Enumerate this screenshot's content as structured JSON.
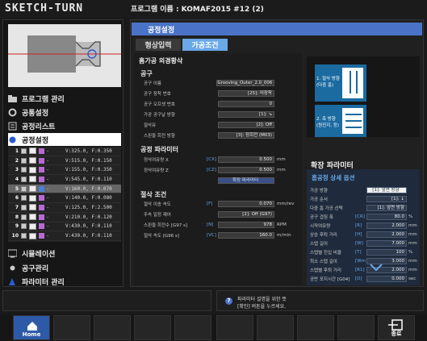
{
  "header": {
    "logo": "SKETCH-TURN",
    "program_title": "프로그램 이름 : KOMAF2015 #12 (2)"
  },
  "nav": [
    {
      "label": "프로그램 관리",
      "icon": "folder-icon"
    },
    {
      "label": "공통설정",
      "icon": "gear-icon"
    },
    {
      "label": "공정리스트",
      "icon": "list-icon"
    },
    {
      "label": "공정설정",
      "icon": "settings-icon"
    },
    {
      "label": "시뮬레이션",
      "icon": "simulation-icon"
    },
    {
      "label": "공구관리",
      "icon": "tool-icon"
    },
    {
      "label": "파라미터 관리",
      "icon": "parameter-icon"
    }
  ],
  "steps": [
    {
      "num": "1",
      "val": "V:325.0, F:0.350"
    },
    {
      "num": "2",
      "val": "V:515.0, F:0.150"
    },
    {
      "num": "3",
      "val": "V:155.0, F:0.350"
    },
    {
      "num": "4",
      "val": "V:545.0, F:0.110"
    },
    {
      "num": "5",
      "val": "V:160.0, F:0.070"
    },
    {
      "num": "6",
      "val": "V:140.0, F:0.080"
    },
    {
      "num": "7",
      "val": "V:125.0, F:2.500"
    },
    {
      "num": "8",
      "val": "V:210.0, F:0.120"
    },
    {
      "num": "9",
      "val": "V:430.0, F:0.110"
    },
    {
      "num": "10",
      "val": "V:430.0, F:0.110"
    }
  ],
  "main": {
    "section_title": "공정설정",
    "tabs": [
      "형상입력",
      "가공조건"
    ],
    "process_name": "홈가공 외경황삭",
    "tool_group": "공구",
    "tool_rows": [
      {
        "label": "공구 이름",
        "key": "",
        "value": "Grooving_Outer_2.0_006",
        "unit": ""
      },
      {
        "label": "공구 장착 번호",
        "key": "",
        "value": "[25]: 미장착",
        "unit": ""
      },
      {
        "label": "공구 오프셋 번호",
        "key": "",
        "value": "0",
        "unit": ""
      },
      {
        "label": "가공 공구날 방향",
        "key": "",
        "value": "[1]: ↘",
        "unit": ""
      },
      {
        "label": "절삭유",
        "key": "",
        "value": "[2]: Off",
        "unit": ""
      },
      {
        "label": "스핀들 회전 방향",
        "key": "",
        "value": "[3]: 정회전 (M03)",
        "unit": ""
      }
    ],
    "tool_param_group": "공정 파라미터",
    "param_rows": [
      {
        "label": "정삭여유량 X",
        "key": "[CX]",
        "value": "0.500",
        "unit": "mm"
      },
      {
        "label": "정삭여유량 Z",
        "key": "[CZ]",
        "value": "0.500",
        "unit": "mm"
      }
    ],
    "advanced_button": "확장 파라미터",
    "cut_group": "절삭 조건",
    "cut_rows": [
      {
        "label": "절삭 이송 속도",
        "key": "[F]",
        "value": "0.070",
        "unit": "mm/rev"
      },
      {
        "label": "주속 일정 제어",
        "key": "",
        "value": "[2]: Off (G97)",
        "unit": ""
      },
      {
        "label": "스핀들 회전수 [G97 s]",
        "key": "[N]",
        "value": "978",
        "unit": "RPM"
      },
      {
        "label": "절삭 속도 [G96 s]",
        "key": "[VC]",
        "value": "160.0",
        "unit": "m/min"
      }
    ]
  },
  "diagram": {
    "label1": "1. 절삭 방향\n(다중 홈)",
    "label2": "2. 축 방향\n(원진지, 등)"
  },
  "ext": {
    "title": "확장 파라미터",
    "subtitle": "홈공정 상세 옵션",
    "rows": [
      {
        "label": "가공 방향",
        "key": "",
        "value": "[1]: 앞면 방향",
        "unit": ""
      },
      {
        "label": "가공 순서",
        "key": "",
        "value": "[1]: ↓",
        "unit": ""
      },
      {
        "label": "다중 홈 가공 선택",
        "key": "",
        "value": "[1]: 앞면 방향",
        "unit": ""
      },
      {
        "label": "공구 겹침 폭",
        "key": "[CR]",
        "value": "80.0",
        "unit": "%"
      },
      {
        "label": "시작여유량",
        "key": "[R]",
        "value": "2.000",
        "unit": "mm"
      },
      {
        "label": "상승 후퇴 거리",
        "key": "[H]",
        "value": "2.000",
        "unit": "mm"
      },
      {
        "label": "스텝 길이",
        "key": "[W]",
        "value": "7.000",
        "unit": "mm"
      },
      {
        "label": "스텝별 진입 비율",
        "key": "[T]",
        "value": "100",
        "unit": "%"
      },
      {
        "label": "최소 스텝 길이",
        "key": "[Wm]",
        "value": "3.000",
        "unit": "mm"
      },
      {
        "label": "스텝별 후퇴 거리",
        "key": "[R1]",
        "value": "2.000",
        "unit": "mm"
      },
      {
        "label": "공반 포지시간 [G04]",
        "key": "[D]",
        "value": "0.000",
        "unit": "sec"
      }
    ]
  },
  "status": {
    "hint_line1": "파라미터 설명을 위한 뜻",
    "hint_line2": "[확인] 버튼을 누르세요."
  },
  "footer": {
    "home": "Home",
    "exit": "종료"
  }
}
